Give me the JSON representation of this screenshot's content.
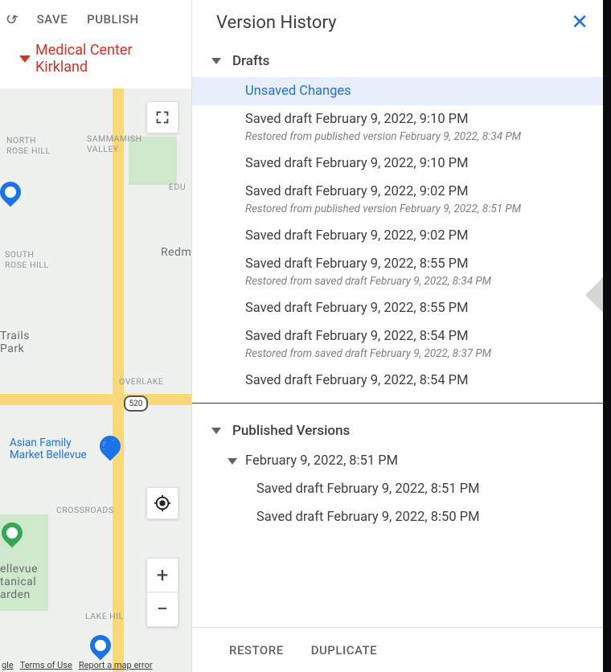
{
  "toolbar": {
    "save_label": "SAVE",
    "publish_label": "PUBLISH"
  },
  "place_title": "Medical Center Kirkland",
  "map": {
    "labels": {
      "north_rose_hill": "NORTH\nROSE HILL",
      "sammamish_valley": "SAMMAMISH\nVALLEY",
      "edu": "EDU",
      "south_rose_hill": "SOUTH\nROSE HILL",
      "redmond_partial": "Redm",
      "trails_park": "Trails\nPark",
      "overlake": "OVERLAKE",
      "crossroads": "CROSSROADS",
      "asian_family_market": "Asian Family\nMarket Bellevue",
      "bellevue_garden": "ellevue\ntanical\narden",
      "lake_hill_partial": "LAKE HIL",
      "route_520": "520"
    },
    "footer": {
      "gle": "gle",
      "terms": "Terms of Use",
      "report": "Report a map error"
    }
  },
  "panel": {
    "title": "Version History",
    "sections": {
      "drafts": {
        "label": "Drafts",
        "items": [
          {
            "title": "Unsaved Changes",
            "selected": true
          },
          {
            "title": "Saved draft February 9, 2022, 9:10 PM",
            "note": "Restored from published version February 9, 2022, 8:34 PM"
          },
          {
            "title": "Saved draft February 9, 2022, 9:10 PM"
          },
          {
            "title": "Saved draft February 9, 2022, 9:02 PM",
            "note": "Restored from published version February 9, 2022, 8:51 PM"
          },
          {
            "title": "Saved draft February 9, 2022, 9:02 PM"
          },
          {
            "title": "Saved draft February 9, 2022, 8:55 PM",
            "note": "Restored from saved draft February 9, 2022, 8:34 PM"
          },
          {
            "title": "Saved draft February 9, 2022, 8:55 PM"
          },
          {
            "title": "Saved draft February 9, 2022, 8:54 PM",
            "note": "Restored from saved draft February 9, 2022, 8:37 PM"
          },
          {
            "title": "Saved draft February 9, 2022, 8:54 PM"
          }
        ]
      },
      "published": {
        "label": "Published Versions",
        "group_title": "February 9, 2022, 8:51 PM",
        "items": [
          {
            "title": "Saved draft February 9, 2022, 8:51 PM"
          },
          {
            "title": "Saved draft February 9, 2022, 8:50 PM"
          }
        ]
      }
    },
    "footer": {
      "restore": "RESTORE",
      "duplicate": "DUPLICATE"
    }
  }
}
